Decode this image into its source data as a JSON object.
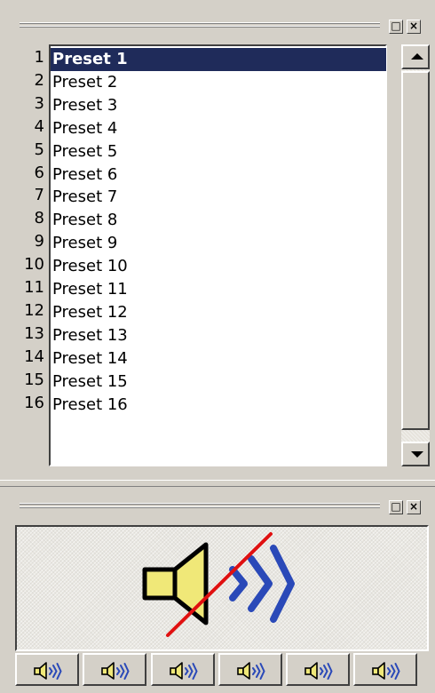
{
  "top_window": {
    "restore_glyph": "□",
    "close_glyph": "×"
  },
  "preset_list": {
    "selected_index": 0,
    "items": [
      {
        "number": "1",
        "label": "Preset 1"
      },
      {
        "number": "2",
        "label": "Preset 2"
      },
      {
        "number": "3",
        "label": "Preset 3"
      },
      {
        "number": "4",
        "label": "Preset 4"
      },
      {
        "number": "5",
        "label": "Preset 5"
      },
      {
        "number": "6",
        "label": "Preset 6"
      },
      {
        "number": "7",
        "label": "Preset 7"
      },
      {
        "number": "8",
        "label": "Preset 8"
      },
      {
        "number": "9",
        "label": "Preset 9"
      },
      {
        "number": "10",
        "label": "Preset 10"
      },
      {
        "number": "11",
        "label": "Preset 11"
      },
      {
        "number": "12",
        "label": "Preset 12"
      },
      {
        "number": "13",
        "label": "Preset 13"
      },
      {
        "number": "14",
        "label": "Preset 14"
      },
      {
        "number": "15",
        "label": "Preset 15"
      },
      {
        "number": "16",
        "label": "Preset 16"
      }
    ]
  },
  "bottom_window": {
    "restore_glyph": "□",
    "close_glyph": "×",
    "main_icon": "speaker-muted-icon",
    "speaker_buttons": [
      {
        "icon": "speaker-icon"
      },
      {
        "icon": "speaker-icon"
      },
      {
        "icon": "speaker-icon"
      },
      {
        "icon": "speaker-icon"
      },
      {
        "icon": "speaker-icon"
      },
      {
        "icon": "speaker-icon"
      }
    ]
  },
  "colors": {
    "selection_bg": "#1f2b5a",
    "speaker_fill": "#f0e878",
    "wave_blue": "#2a49b8",
    "mute_line": "#e01010"
  }
}
